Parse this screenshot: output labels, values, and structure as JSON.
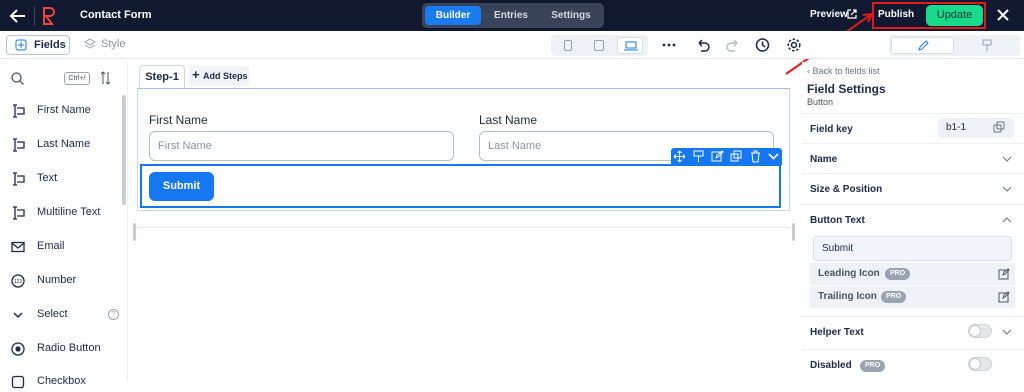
{
  "topbar": {
    "title": "Contact Form",
    "tabs": [
      {
        "label": "Builder",
        "active": true
      },
      {
        "label": "Entries"
      },
      {
        "label": "Settings"
      }
    ],
    "preview_label": "Preview",
    "publish_label": "Publish",
    "update_label": "Update"
  },
  "toolbar": {
    "fields_label": "Fields",
    "style_label": "Style",
    "shortcut": "Ctrl+/"
  },
  "sidebar": {
    "items": [
      {
        "label": "First Name",
        "icon": "text-cursor-icon"
      },
      {
        "label": "Last Name",
        "icon": "text-cursor-icon"
      },
      {
        "label": "Text",
        "icon": "text-cursor-icon"
      },
      {
        "label": "Multiline Text",
        "icon": "text-cursor-icon"
      },
      {
        "label": "Email",
        "icon": "envelope-icon"
      },
      {
        "label": "Number",
        "icon": "number-icon"
      },
      {
        "label": "Select",
        "icon": "chevron-down-icon"
      },
      {
        "label": "Radio Button",
        "icon": "radio-icon"
      },
      {
        "label": "Checkbox",
        "icon": "checkbox-icon"
      }
    ]
  },
  "canvas": {
    "step_label": "Step-1",
    "add_steps_label": "Add Steps",
    "first_name_label": "First Name",
    "first_name_placeholder": "First Name",
    "last_name_label": "Last Name",
    "last_name_placeholder": "Last Name",
    "submit_label": "Submit"
  },
  "panel": {
    "back_label": "Back to fields list",
    "title": "Field Settings",
    "subtitle": "Button",
    "field_key_label": "Field key",
    "field_key_value": "b1-1",
    "name_label": "Name",
    "size_position_label": "Size & Position",
    "button_text_label": "Button Text",
    "button_text_value": "Submit",
    "leading_icon_label": "Leading Icon",
    "trailing_icon_label": "Trailing Icon",
    "pro_badge": "PRO",
    "helper_text_label": "Helper Text",
    "disabled_label": "Disabled"
  },
  "colors": {
    "topbar": "#10192f",
    "accent": "#1677f2",
    "update": "#19d98c",
    "highlight": "#e01b1b"
  }
}
